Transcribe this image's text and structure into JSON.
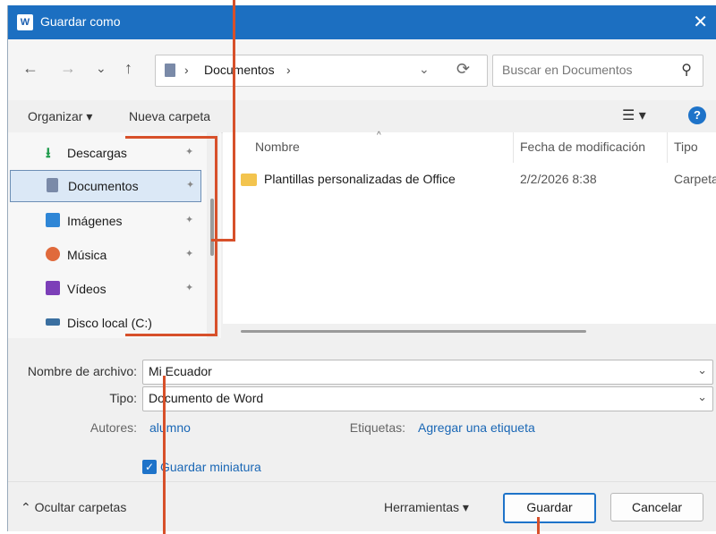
{
  "window": {
    "title": "Guardar como",
    "app_icon_letter": "W",
    "close_glyph": "✕"
  },
  "nav": {
    "back": "←",
    "forward": "→",
    "recent": "⌄",
    "up": "↑",
    "path_sep": "›",
    "breadcrumb": "Documentos",
    "dropdown": "⌄",
    "refresh": "⟳"
  },
  "search": {
    "placeholder": "Buscar en Documentos"
  },
  "toolbar": {
    "organize": "Organizar ▾",
    "new_folder": "Nueva carpeta",
    "views": "☰ ▾",
    "help": "?"
  },
  "sidebar": {
    "items": [
      {
        "label": "Descargas",
        "icon": "download-icon",
        "pinned": true
      },
      {
        "label": "Documentos",
        "icon": "documents-icon",
        "pinned": true,
        "selected": true
      },
      {
        "label": "Imágenes",
        "icon": "pictures-icon",
        "pinned": true
      },
      {
        "label": "Música",
        "icon": "music-icon",
        "pinned": true
      },
      {
        "label": "Vídeos",
        "icon": "videos-icon",
        "pinned": true
      },
      {
        "label": "Disco local (C:)",
        "icon": "drive-icon",
        "pinned": false
      }
    ],
    "pin_glyph": "📌"
  },
  "files": {
    "columns": [
      "Nombre",
      "Fecha de modificación",
      "Tipo"
    ],
    "rows": [
      {
        "name": "Plantillas personalizadas de Office",
        "date": "2/2/2026 8:38",
        "type": "Carpeta"
      }
    ]
  },
  "form": {
    "filename_label": "Nombre de archivo:",
    "filename_value": "Mi Ecuador",
    "type_label": "Tipo:",
    "type_value": "Documento de Word",
    "authors_label": "Autores:",
    "authors_value": "alumno",
    "tags_label": "Etiquetas:",
    "tags_value": "Agregar una etiqueta",
    "thumbnail_label": "Guardar miniatura",
    "thumbnail_checked": true
  },
  "footer": {
    "hide_folders": "⌃  Ocultar carpetas",
    "tools": "Herramientas  ▾",
    "save": "Guardar",
    "cancel": "Cancelar"
  },
  "colors": {
    "titlebar": "#1c6fc1",
    "accent": "#1e73c9",
    "annotation": "#d7502a"
  }
}
